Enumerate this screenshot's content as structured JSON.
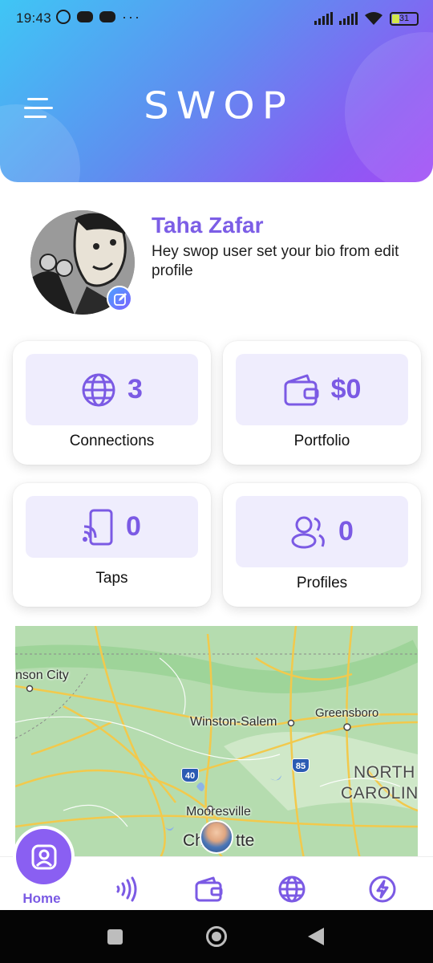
{
  "status_bar": {
    "time": "19:43",
    "battery": "31",
    "overflow": "···"
  },
  "header": {
    "logo": "SWOP",
    "menu_icon": "hamburger-menu-icon"
  },
  "profile": {
    "name": "Taha Zafar",
    "bio": "Hey swop user set your bio from edit profile",
    "edit_icon": "edit-icon"
  },
  "stats": [
    {
      "value": "3",
      "label": "Connections",
      "icon": "globe-icon"
    },
    {
      "value": "$0",
      "label": "Portfolio",
      "icon": "wallet-icon"
    },
    {
      "value": "0",
      "label": "Taps",
      "icon": "nfc-tap-icon"
    },
    {
      "value": "0",
      "label": "Profiles",
      "icon": "users-icon"
    }
  ],
  "map": {
    "cities": [
      "nson City",
      "Winston-Salem",
      "Greensboro",
      "Mooresville",
      "Ch",
      "tte"
    ],
    "state": [
      "NORTH",
      "CAROLINA"
    ],
    "shields": [
      "40",
      "85"
    ]
  },
  "nav": {
    "home_label": "Home",
    "items": [
      "home-icon",
      "nfc-waves-icon",
      "wallet-icon",
      "globe-icon",
      "lightning-icon"
    ]
  },
  "colors": {
    "accent": "#7b5ae4",
    "tile_bg": "#efedfd",
    "header_start": "#3fc6f5",
    "header_end": "#a14cf5"
  }
}
